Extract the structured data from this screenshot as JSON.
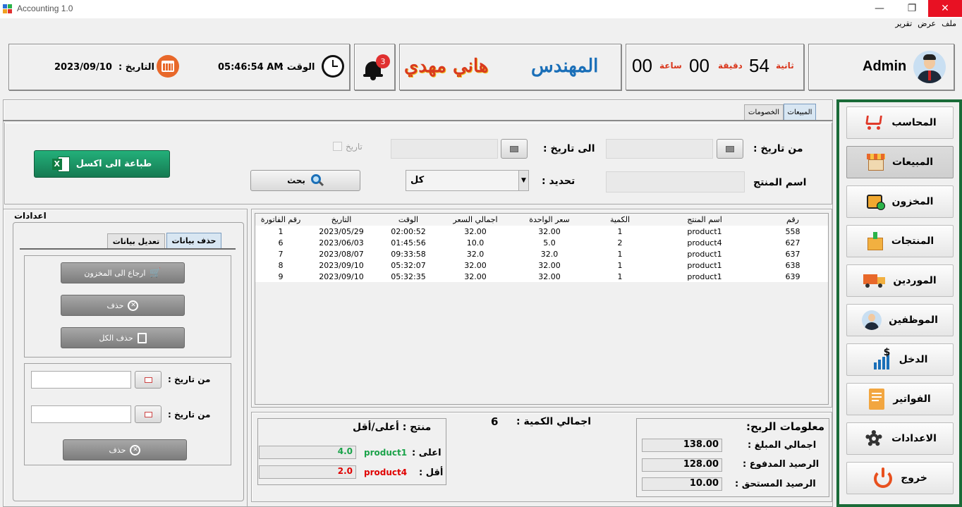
{
  "window": {
    "title": "Accounting 1.0",
    "minimize": "—",
    "maximize": "❐",
    "close": "✕"
  },
  "menu": [
    "ملف",
    "عرض",
    "تقرير"
  ],
  "header": {
    "user_name": "Admin",
    "timer": {
      "seconds": "54",
      "seconds_label": "ثانية",
      "minutes": "00",
      "minutes_label": "دقيقة",
      "hours": "00",
      "hours_label": "ساعة"
    },
    "engineer_title": "المهندس",
    "engineer_name": "هاني مهدي",
    "notifications_count": "3",
    "time_label": "الوقت :",
    "time_value": "05:46:54 AM",
    "date_label": "التاريخ :",
    "date_value": "2023/09/10"
  },
  "sidebar": {
    "items": [
      {
        "label": "المحاسب",
        "icon": "cart-icon"
      },
      {
        "label": "المبيعات",
        "icon": "store-icon"
      },
      {
        "label": "المخزون",
        "icon": "box-icon"
      },
      {
        "label": "المنتجات",
        "icon": "products-icon"
      },
      {
        "label": "الموردين",
        "icon": "truck-icon"
      },
      {
        "label": "الموظفين",
        "icon": "employee-icon"
      },
      {
        "label": "الدخل",
        "icon": "income-chart-icon"
      },
      {
        "label": "الفواتير",
        "icon": "invoice-icon"
      },
      {
        "label": "الاعدادات",
        "icon": "gear-icon"
      },
      {
        "label": "خروج",
        "icon": "power-icon"
      }
    ]
  },
  "tabs": {
    "sales": "المبيعات",
    "discounts": "الخصومات"
  },
  "filters": {
    "from_date_label": "من تاريخ :",
    "to_date_label": "الى تاريخ :",
    "date_checkbox_label": "تاريخ",
    "product_name_label": "اسم المنتج",
    "select_label": "تحديد :",
    "select_value": "كل",
    "search_button": "بحث",
    "excel_button": "طباعة الى اكسل"
  },
  "table": {
    "columns": [
      "رقم",
      "اسم المنتج",
      "الكمية",
      "سعر الواحدة",
      "اجمالي السعر",
      "الوقت",
      "التاريخ",
      "رقم الفاتورة"
    ],
    "rows": [
      [
        "558",
        "product1",
        "1",
        "32.00",
        "32.00",
        "02:00:52",
        "2023/05/29",
        "1"
      ],
      [
        "627",
        "product4",
        "2",
        "5.0",
        "10.0",
        "01:45:56",
        "2023/06/03",
        "6"
      ],
      [
        "637",
        "product1",
        "1",
        "32.0",
        "32.0",
        "09:33:58",
        "2023/08/07",
        "7"
      ],
      [
        "638",
        "product1",
        "1",
        "32.00",
        "32.00",
        "05:32:07",
        "2023/09/10",
        "8"
      ],
      [
        "639",
        "product1",
        "1",
        "32.00",
        "32.00",
        "05:32:35",
        "2023/09/10",
        "9"
      ]
    ]
  },
  "settings": {
    "title": "اعدادات",
    "tab_delete": "حذف بيانات",
    "tab_edit": "تعديل بيانات",
    "return_button": "ارجاع الى المخزون",
    "delete_button": "حذف",
    "delete_all_button": "حذف الكل",
    "from_date_label_1": "من تاريخ :",
    "from_date_label_2": "من تاريخ :",
    "delete_range_button": "حذف"
  },
  "profit": {
    "title": "معلومات الربح:",
    "total_label": "اجمالي المبلغ :",
    "total_value": "138.00",
    "paid_label": "الرصيد المدفوع :",
    "paid_value": "128.00",
    "due_label": "الرصيد المستحق :",
    "due_value": "10.00"
  },
  "quantity": {
    "label": "اجمالي الكمية :",
    "value": "6"
  },
  "product_stats": {
    "title": "منتج : أعلى/أقل",
    "top_label": "اعلى :",
    "top_product": "product1",
    "top_value": "4.0",
    "low_label": "أقل :",
    "low_product": "product4",
    "low_value": "2.0"
  },
  "colors": {
    "accent_green": "#1aa34a",
    "excel_green": "#1e9e6a",
    "red": "#e00000",
    "orange": "#e8682a",
    "timer_red": "#d9381e"
  }
}
